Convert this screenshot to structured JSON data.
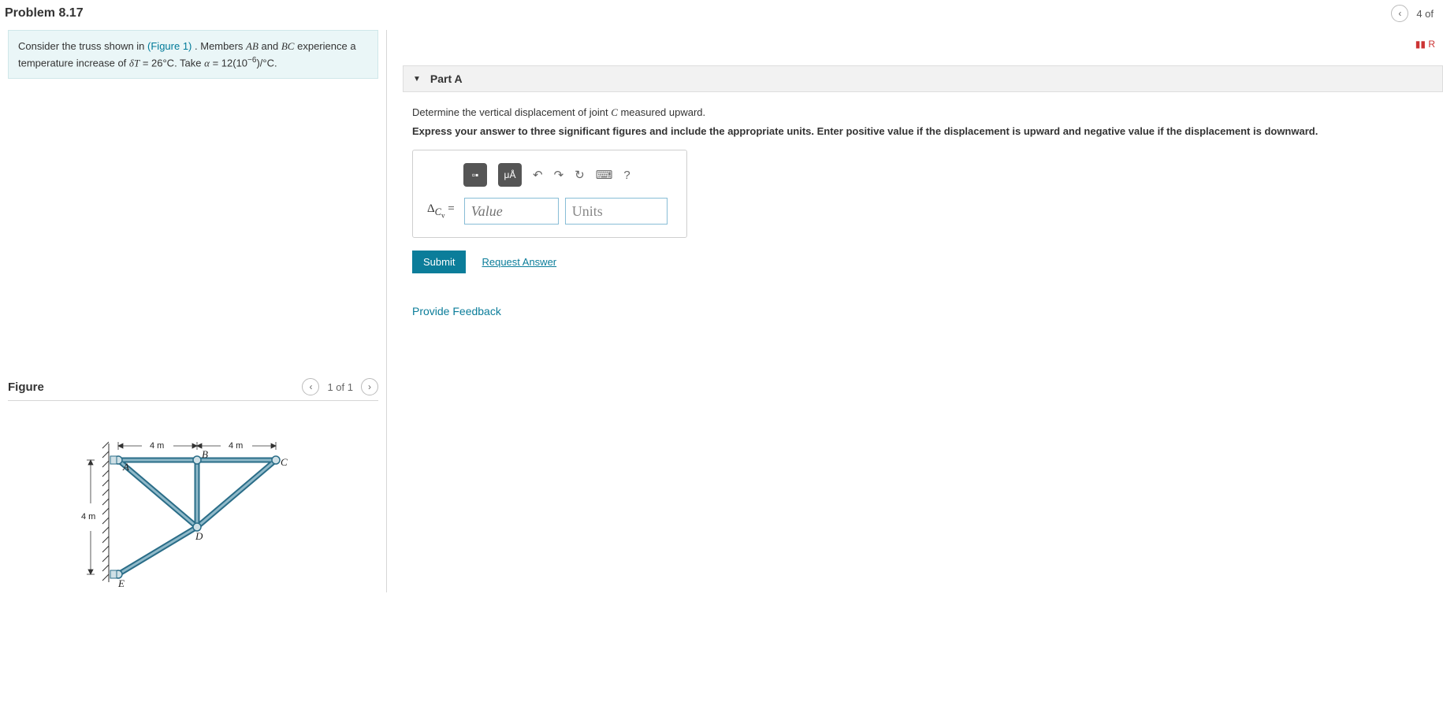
{
  "header": {
    "title": "Problem 8.17",
    "nav_prev_glyph": "‹",
    "page_position": "4 of",
    "flag_glyph": "▮▮ R"
  },
  "intro": {
    "text_prefix": "Consider the truss shown in ",
    "figure_link_text": "(Figure 1)",
    "text_mid1": ". Members ",
    "member1": "AB",
    "text_mid2": " and ",
    "member2": "BC",
    "text_mid3": " experience a temperature increase of ",
    "deltaT_sym": "δT",
    "deltaT_val": " = 26°C. Take ",
    "alpha_sym": "α",
    "alpha_val": " = 12(10",
    "alpha_exp": "−6",
    "alpha_unit": ")/°C."
  },
  "figure": {
    "heading": "Figure",
    "nav_text": "1 of 1",
    "prev_glyph": "‹",
    "next_glyph": "›",
    "labels": {
      "dim_top1": "4 m",
      "dim_top2": "4 m",
      "dim_side": "4 m",
      "A": "A",
      "B": "B",
      "C": "C",
      "D": "D",
      "E": "E"
    }
  },
  "part": {
    "arrow": "▼",
    "title": "Part A",
    "prompt_line1_pre": "Determine the vertical displacement of joint ",
    "prompt_line1_sym": "C",
    "prompt_line1_post": " measured upward.",
    "prompt_line2": "Express your answer to three significant figures and include the appropriate units. Enter positive value if the displacement is upward and negative value if the displacement is downward.",
    "answer_label_html": "Δ",
    "answer_sub": "C",
    "answer_subsub": "v",
    "answer_eq": " =",
    "value_placeholder": "Value",
    "units_placeholder": "Units",
    "submit_label": "Submit",
    "request_label": "Request Answer",
    "toolbar": {
      "templates_icon": "▫▪",
      "units_icon": "μÅ",
      "undo_icon": "↶",
      "redo_icon": "↷",
      "reset_icon": "↻",
      "keyboard_icon": "⌨",
      "help_icon": "?"
    }
  },
  "feedback_link": "Provide Feedback"
}
